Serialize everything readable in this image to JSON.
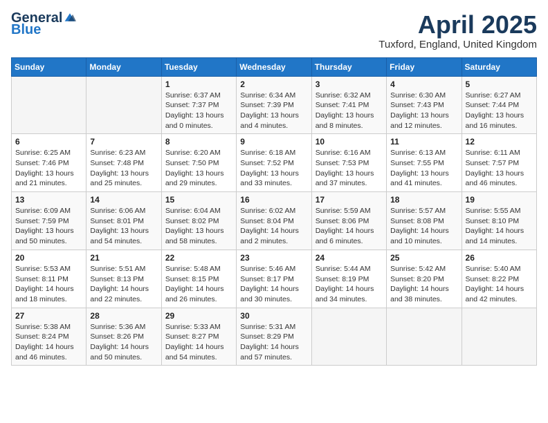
{
  "header": {
    "logo_general": "General",
    "logo_blue": "Blue",
    "title": "April 2025",
    "location": "Tuxford, England, United Kingdom"
  },
  "weekdays": [
    "Sunday",
    "Monday",
    "Tuesday",
    "Wednesday",
    "Thursday",
    "Friday",
    "Saturday"
  ],
  "weeks": [
    [
      {
        "day": "",
        "info": ""
      },
      {
        "day": "",
        "info": ""
      },
      {
        "day": "1",
        "info": "Sunrise: 6:37 AM\nSunset: 7:37 PM\nDaylight: 13 hours and 0 minutes."
      },
      {
        "day": "2",
        "info": "Sunrise: 6:34 AM\nSunset: 7:39 PM\nDaylight: 13 hours and 4 minutes."
      },
      {
        "day": "3",
        "info": "Sunrise: 6:32 AM\nSunset: 7:41 PM\nDaylight: 13 hours and 8 minutes."
      },
      {
        "day": "4",
        "info": "Sunrise: 6:30 AM\nSunset: 7:43 PM\nDaylight: 13 hours and 12 minutes."
      },
      {
        "day": "5",
        "info": "Sunrise: 6:27 AM\nSunset: 7:44 PM\nDaylight: 13 hours and 16 minutes."
      }
    ],
    [
      {
        "day": "6",
        "info": "Sunrise: 6:25 AM\nSunset: 7:46 PM\nDaylight: 13 hours and 21 minutes."
      },
      {
        "day": "7",
        "info": "Sunrise: 6:23 AM\nSunset: 7:48 PM\nDaylight: 13 hours and 25 minutes."
      },
      {
        "day": "8",
        "info": "Sunrise: 6:20 AM\nSunset: 7:50 PM\nDaylight: 13 hours and 29 minutes."
      },
      {
        "day": "9",
        "info": "Sunrise: 6:18 AM\nSunset: 7:52 PM\nDaylight: 13 hours and 33 minutes."
      },
      {
        "day": "10",
        "info": "Sunrise: 6:16 AM\nSunset: 7:53 PM\nDaylight: 13 hours and 37 minutes."
      },
      {
        "day": "11",
        "info": "Sunrise: 6:13 AM\nSunset: 7:55 PM\nDaylight: 13 hours and 41 minutes."
      },
      {
        "day": "12",
        "info": "Sunrise: 6:11 AM\nSunset: 7:57 PM\nDaylight: 13 hours and 46 minutes."
      }
    ],
    [
      {
        "day": "13",
        "info": "Sunrise: 6:09 AM\nSunset: 7:59 PM\nDaylight: 13 hours and 50 minutes."
      },
      {
        "day": "14",
        "info": "Sunrise: 6:06 AM\nSunset: 8:01 PM\nDaylight: 13 hours and 54 minutes."
      },
      {
        "day": "15",
        "info": "Sunrise: 6:04 AM\nSunset: 8:02 PM\nDaylight: 13 hours and 58 minutes."
      },
      {
        "day": "16",
        "info": "Sunrise: 6:02 AM\nSunset: 8:04 PM\nDaylight: 14 hours and 2 minutes."
      },
      {
        "day": "17",
        "info": "Sunrise: 5:59 AM\nSunset: 8:06 PM\nDaylight: 14 hours and 6 minutes."
      },
      {
        "day": "18",
        "info": "Sunrise: 5:57 AM\nSunset: 8:08 PM\nDaylight: 14 hours and 10 minutes."
      },
      {
        "day": "19",
        "info": "Sunrise: 5:55 AM\nSunset: 8:10 PM\nDaylight: 14 hours and 14 minutes."
      }
    ],
    [
      {
        "day": "20",
        "info": "Sunrise: 5:53 AM\nSunset: 8:11 PM\nDaylight: 14 hours and 18 minutes."
      },
      {
        "day": "21",
        "info": "Sunrise: 5:51 AM\nSunset: 8:13 PM\nDaylight: 14 hours and 22 minutes."
      },
      {
        "day": "22",
        "info": "Sunrise: 5:48 AM\nSunset: 8:15 PM\nDaylight: 14 hours and 26 minutes."
      },
      {
        "day": "23",
        "info": "Sunrise: 5:46 AM\nSunset: 8:17 PM\nDaylight: 14 hours and 30 minutes."
      },
      {
        "day": "24",
        "info": "Sunrise: 5:44 AM\nSunset: 8:19 PM\nDaylight: 14 hours and 34 minutes."
      },
      {
        "day": "25",
        "info": "Sunrise: 5:42 AM\nSunset: 8:20 PM\nDaylight: 14 hours and 38 minutes."
      },
      {
        "day": "26",
        "info": "Sunrise: 5:40 AM\nSunset: 8:22 PM\nDaylight: 14 hours and 42 minutes."
      }
    ],
    [
      {
        "day": "27",
        "info": "Sunrise: 5:38 AM\nSunset: 8:24 PM\nDaylight: 14 hours and 46 minutes."
      },
      {
        "day": "28",
        "info": "Sunrise: 5:36 AM\nSunset: 8:26 PM\nDaylight: 14 hours and 50 minutes."
      },
      {
        "day": "29",
        "info": "Sunrise: 5:33 AM\nSunset: 8:27 PM\nDaylight: 14 hours and 54 minutes."
      },
      {
        "day": "30",
        "info": "Sunrise: 5:31 AM\nSunset: 8:29 PM\nDaylight: 14 hours and 57 minutes."
      },
      {
        "day": "",
        "info": ""
      },
      {
        "day": "",
        "info": ""
      },
      {
        "day": "",
        "info": ""
      }
    ]
  ]
}
